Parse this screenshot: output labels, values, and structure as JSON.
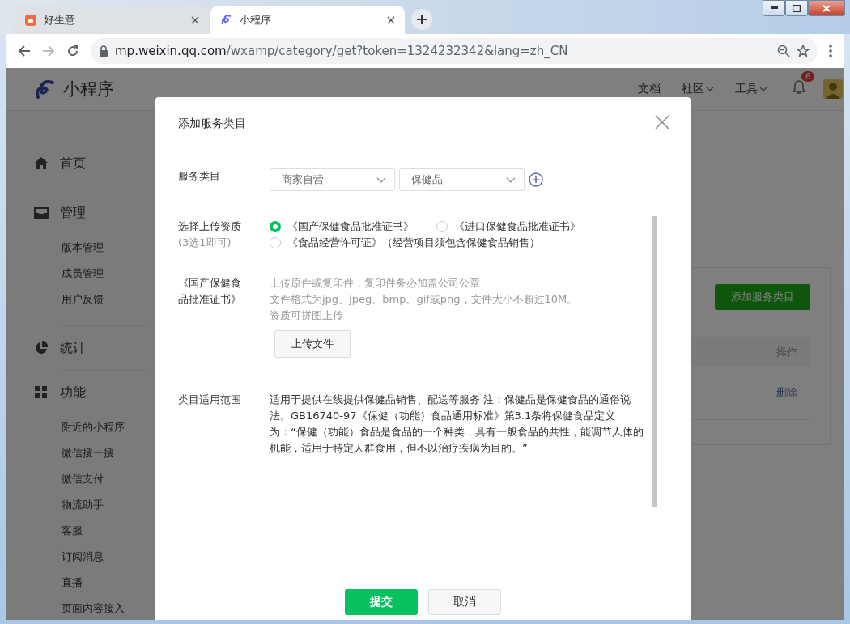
{
  "browser": {
    "tabs": [
      {
        "title": "好生意",
        "selected": false
      },
      {
        "title": "小程序",
        "selected": true
      }
    ],
    "url": {
      "host": "mp.weixin.qq.com",
      "path": "/wxamp/category/get?token=1324232342&lang=zh_CN"
    }
  },
  "header": {
    "logo": "小程序",
    "nav": [
      {
        "label": "文档",
        "dropdown": false
      },
      {
        "label": "社区",
        "dropdown": true
      },
      {
        "label": "工具",
        "dropdown": true
      }
    ],
    "notifications": "6"
  },
  "sidebar": {
    "sections": [
      {
        "kind": "home",
        "label": "首页"
      },
      {
        "kind": "inbox",
        "label": "管理",
        "items": [
          "版本管理",
          "成员管理",
          "用户反馈"
        ]
      },
      {
        "kind": "pie",
        "label": "统计"
      },
      {
        "kind": "grid",
        "label": "功能",
        "items": [
          "附近的小程序",
          "微信搜一搜",
          "微信支付",
          "物流助手",
          "客服",
          "订阅消息",
          "直播",
          "页面内容接入"
        ]
      }
    ]
  },
  "content": {
    "add_button": "添加服务类目",
    "table": {
      "header": "操作",
      "rows": [
        {
          "action": "删除"
        }
      ]
    }
  },
  "dialog": {
    "title": "添加服务类目",
    "category": {
      "label": "服务类目",
      "selects": [
        "商家自营",
        "保健品"
      ]
    },
    "qualification": {
      "label": "选择上传资质",
      "hint": "(3选1即可)",
      "options": [
        {
          "label": "《国产保健食品批准证书》",
          "selected": true
        },
        {
          "label": "《进口保健食品批准证书》",
          "selected": false
        },
        {
          "label": "《食品经营许可证》（经营项目须包含保健食品销售）",
          "selected": false
        }
      ]
    },
    "upload": {
      "label": "《国产保健食品批准证书》",
      "notes": [
        "上传原件或复印件，复印件务必加盖公司公章",
        "文件格式为jpg、jpeg、bmp、gif或png，文件大小不超过10M。",
        "资质可拼图上传"
      ],
      "button": "上传文件"
    },
    "scope": {
      "label": "类目适用范围",
      "text": "适用于提供在线提供保健品销售、配送等服务 注：保健品是保健食品的通俗说法。GB16740-97《保健（功能）食品通用标准》第3.1条将保健食品定义为：“保健（功能）食品是食品的一个种类，具有一般食品的共性，能调节人体的机能，适用于特定人群食用，但不以治疗疾病为目的。”"
    },
    "buttons": [
      {
        "label": "提交",
        "kind": "primary"
      },
      {
        "label": "取消",
        "kind": "default"
      }
    ]
  }
}
